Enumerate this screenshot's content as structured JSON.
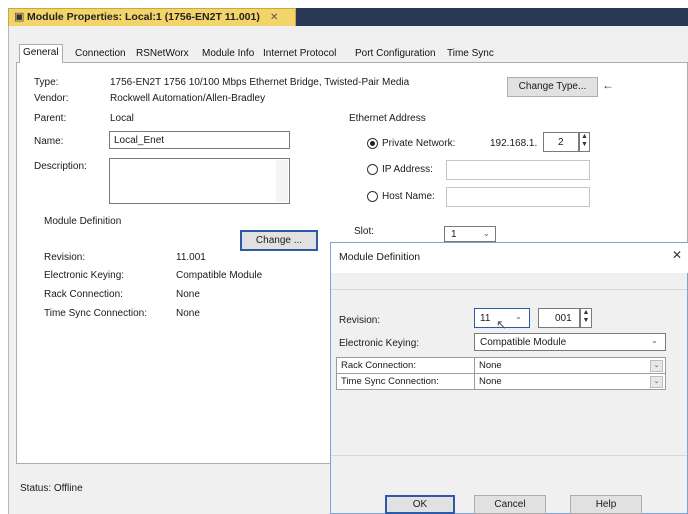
{
  "window": {
    "title": "Module Properties: Local:1 (1756-EN2T 11.001)",
    "close_glyph": "✕",
    "icon": "document-icon"
  },
  "tabs": [
    "General",
    "Connection",
    "RSNetWorx",
    "Module Info",
    "Internet Protocol",
    "Port Configuration",
    "Time Sync"
  ],
  "general": {
    "type_label": "Type:",
    "type_value": "1756-EN2T 1756 10/100 Mbps Ethernet Bridge, Twisted-Pair Media",
    "vendor_label": "Vendor:",
    "vendor_value": "Rockwell Automation/Allen-Bradley",
    "parent_label": "Parent:",
    "parent_value": "Local",
    "name_label": "Name:",
    "name_value": "Local_Enet",
    "description_label": "Description:",
    "description_value": "",
    "change_type_button": "Change Type...",
    "change_type_arrow": "←"
  },
  "ethernet": {
    "heading": "Ethernet Address",
    "private_label": "Private Network:",
    "private_prefix": "192.168.1.",
    "private_value": "2",
    "ip_label": "IP Address:",
    "host_label": "Host Name:",
    "slot_label": "Slot:",
    "slot_value": "1"
  },
  "module_definition": {
    "heading": "Module Definition",
    "change_button": "Change ...",
    "revision_label": "Revision:",
    "revision_value": "11.001",
    "keying_label": "Electronic Keying:",
    "keying_value": "Compatible Module",
    "rack_label": "Rack Connection:",
    "rack_value": "None",
    "timesync_label": "Time Sync Connection:",
    "timesync_value": "None"
  },
  "status": {
    "text": "Status:  Offline"
  },
  "md_dialog": {
    "title": "Module Definition",
    "close_glyph": "✕",
    "revision_label": "Revision:",
    "revision_major": "11",
    "revision_minor": "001",
    "keying_label": "Electronic Keying:",
    "keying_value": "Compatible Module",
    "rack_label": "Rack Connection:",
    "rack_value": "None",
    "timesync_label": "Time Sync Connection:",
    "timesync_value": "None",
    "ok_button": "OK",
    "cancel_button": "Cancel",
    "help_button": "Help"
  },
  "colors": {
    "title_tab": "#f3d46a",
    "title_bar_dark": "#293955",
    "accent_border": "#2b5aa8"
  }
}
